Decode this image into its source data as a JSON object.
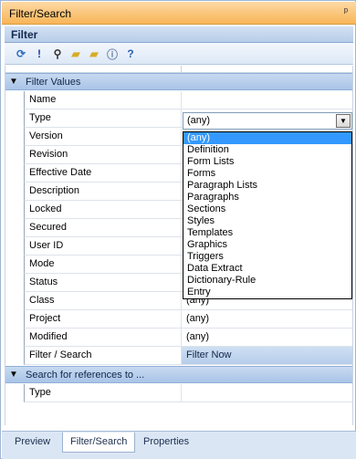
{
  "window": {
    "title": "Filter/Search",
    "pin_glyph": "ᵖ"
  },
  "panel": {
    "title": "Filter"
  },
  "toolbar": [
    {
      "name": "refresh-icon",
      "glyph": "⟳",
      "color": "#2f6fc3"
    },
    {
      "name": "exclamation-icon",
      "glyph": "!",
      "color": "#1b3fa3"
    },
    {
      "name": "binoculars-icon",
      "glyph": "⚲",
      "color": "#333333"
    },
    {
      "name": "folder-open-icon",
      "glyph": "▰",
      "color": "#d6ad2b"
    },
    {
      "name": "folder-icon",
      "glyph": "▰",
      "color": "#d6ad2b"
    },
    {
      "name": "info-icon",
      "glyph": "ⓘ",
      "color": "#6b7fa6"
    },
    {
      "name": "help-icon",
      "glyph": "?",
      "color": "#2a5db5"
    }
  ],
  "sections": {
    "filter_values": "Filter Values",
    "search_refs": "Search for references to ..."
  },
  "rows": [
    {
      "name": "Name",
      "value": ""
    },
    {
      "name": "Type",
      "value": ""
    },
    {
      "name": "Version",
      "value": ""
    },
    {
      "name": "Revision",
      "value": ""
    },
    {
      "name": "Effective Date",
      "value": ""
    },
    {
      "name": "Description",
      "value": ""
    },
    {
      "name": "Locked",
      "value": ""
    },
    {
      "name": "Secured",
      "value": ""
    },
    {
      "name": "User ID",
      "value": ""
    },
    {
      "name": "Mode",
      "value": ""
    },
    {
      "name": "Status",
      "value": ""
    },
    {
      "name": "Class",
      "value": "(any)"
    },
    {
      "name": "Project",
      "value": "(any)"
    },
    {
      "name": "Modified",
      "value": "(any)"
    },
    {
      "name": "Filter / Search",
      "value": "Filter Now"
    }
  ],
  "ref_rows": [
    {
      "name": "Type",
      "value": ""
    }
  ],
  "type_combo": {
    "value": "(any)",
    "options": [
      "(any)",
      "Definition",
      "Form Lists",
      "Forms",
      "Paragraph Lists",
      "Paragraphs",
      "Sections",
      "Styles",
      "Templates",
      "Graphics",
      "Triggers",
      "Data Extract",
      "Dictionary-Rule",
      "Entry"
    ],
    "selected_index": 0
  },
  "tabs": [
    {
      "label": "Preview",
      "active": false
    },
    {
      "label": "Filter/Search",
      "active": true
    },
    {
      "label": "Properties",
      "active": false
    }
  ]
}
